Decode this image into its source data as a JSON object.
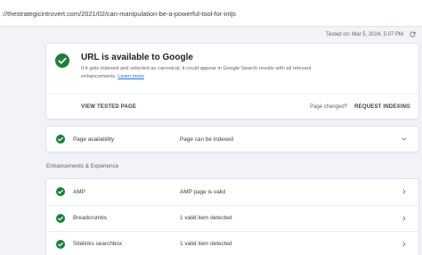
{
  "url_bar": {
    "url": "://thestrategicintrovert.com/2021/02/can-manipulation-be-a-powerful-tool-for-intjs"
  },
  "tested": {
    "text": "Tested on: Mar 5, 2024, 5:07 PM"
  },
  "status": {
    "title": "URL is available to Google",
    "description": "If it gets indexed and selected as canonical, it could appear in Google Search results with all relevant enhancements.",
    "learn_more": "Learn more",
    "accent_color": "#188038"
  },
  "actions": {
    "view_tested_page": "VIEW TESTED PAGE",
    "page_changed": "Page changed?",
    "request_indexing": "REQUEST INDEXING"
  },
  "availability": {
    "label": "Page availability",
    "value": "Page can be indexed"
  },
  "enhancements": {
    "title": "Enhancements & Experience",
    "rows": [
      {
        "label": "AMP",
        "value": "AMP page is valid"
      },
      {
        "label": "Breadcrumbs",
        "value": "1 valid item detected"
      },
      {
        "label": "Sitelinks searchbox",
        "value": "1 valid item detected"
      }
    ]
  }
}
